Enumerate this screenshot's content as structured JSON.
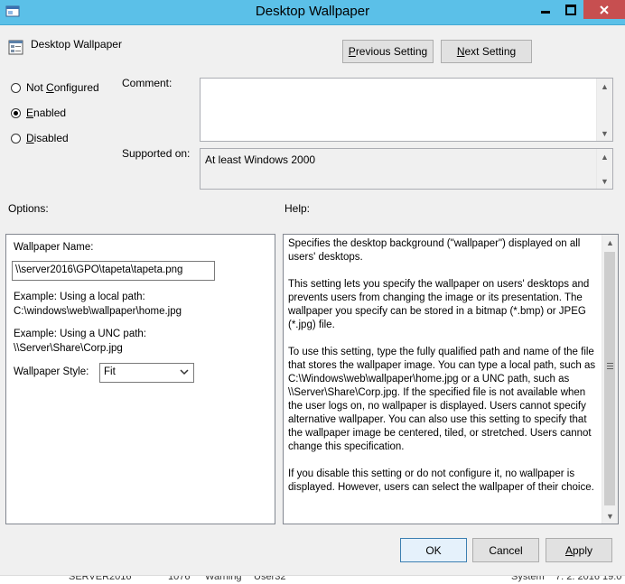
{
  "window": {
    "title": "Desktop Wallpaper",
    "accent_color": "#5bc0e8",
    "close_color": "#c74f50"
  },
  "header": {
    "policy_name": "Desktop Wallpaper",
    "prev_button": {
      "prefix": "",
      "mnemonic": "P",
      "rest": "revious Setting"
    },
    "next_button": {
      "prefix": "",
      "mnemonic": "N",
      "rest": "ext Setting"
    }
  },
  "state": {
    "options": [
      {
        "mnemonic": "C",
        "before": "Not ",
        "after": "onfigured",
        "checked": false
      },
      {
        "mnemonic": "E",
        "before": "",
        "after": "nabled",
        "checked": true
      },
      {
        "mnemonic": "D",
        "before": "",
        "after": "isabled",
        "checked": false
      }
    ]
  },
  "comment": {
    "label": "Comment:",
    "value": ""
  },
  "supported": {
    "label": "Supported on:",
    "value": "At least Windows 2000"
  },
  "options_section": {
    "label": "Options:",
    "wallpaper_name_label": "Wallpaper Name:",
    "wallpaper_name_value": "\\\\server2016\\GPO\\tapeta\\tapeta.png",
    "example_local_1": "Example: Using a local path:",
    "example_local_2": "C:\\windows\\web\\wallpaper\\home.jpg",
    "example_unc_1": "Example: Using a UNC path:",
    "example_unc_2": "\\\\Server\\Share\\Corp.jpg",
    "style_label": "Wallpaper Style:",
    "style_value": "Fit"
  },
  "help_section": {
    "label": "Help:",
    "paragraphs": [
      "Specifies the desktop background (\"wallpaper\") displayed on all users' desktops.",
      "This setting lets you specify the wallpaper on users' desktops and prevents users from changing the image or its presentation. The wallpaper you specify can be stored in a bitmap (*.bmp) or JPEG (*.jpg) file.",
      "To use this setting, type the fully qualified path and name of the file that stores the wallpaper image. You can type a local path, such as C:\\Windows\\web\\wallpaper\\home.jpg or a UNC path, such as \\\\Server\\Share\\Corp.jpg. If the specified file is not available when the user logs on, no wallpaper is displayed. Users cannot specify alternative wallpaper. You can also use this setting to specify that the wallpaper image be centered, tiled, or stretched. Users cannot change this specification.",
      "If you disable this setting or do not configure it, no wallpaper is displayed. However, users can select the wallpaper of their choice."
    ]
  },
  "footer": {
    "ok": "OK",
    "cancel": "Cancel",
    "apply_mnemonic": "A",
    "apply_rest": "pply"
  },
  "background_window": {
    "cells": [
      "SERVER2016",
      "1076",
      "Warning",
      "User32",
      "System",
      "7. 2. 2016 19:0"
    ]
  }
}
